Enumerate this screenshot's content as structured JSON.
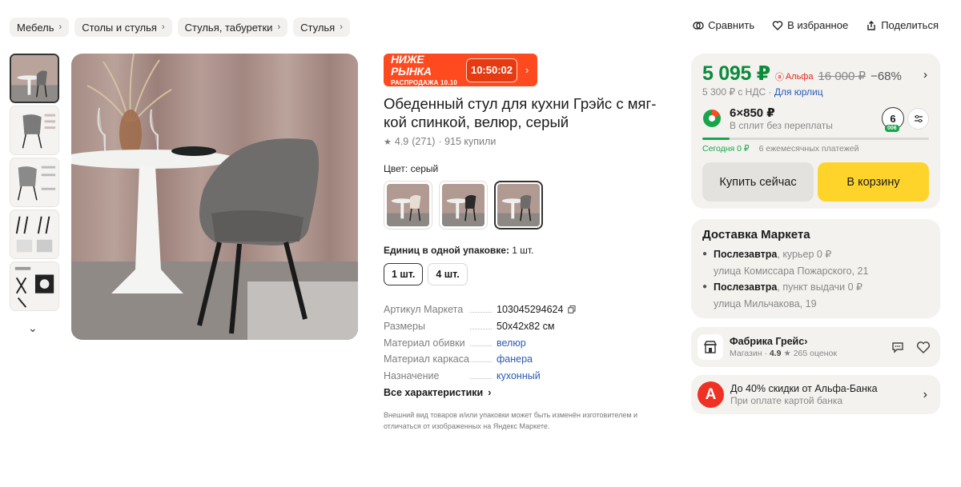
{
  "breadcrumbs": [
    "Мебель",
    "Столы и стулья",
    "Стулья, табуретки",
    "Стулья"
  ],
  "top_actions": {
    "compare": "Сравнить",
    "favorite": "В избранное",
    "share": "Поделиться"
  },
  "promo": {
    "title": "НИЖЕ РЫНКА",
    "subtitle": "РАСПРОДАЖА 10.10",
    "timer": "10:50:02"
  },
  "product": {
    "title": "Обеденный стул для кухни Грэйс с мяг-кой спинкой, велюр, серый",
    "rating": "4.9",
    "reviews": "(271)",
    "bought": "· 915 купили",
    "color_label": "Цвет:",
    "color_value": "серый",
    "pack_label": "Единиц в одной упаковке:",
    "pack_value": "1 шт.",
    "pack_options": [
      "1 шт.",
      "4 шт."
    ],
    "all_specs": "Все характеристики",
    "disclaimer": "Внешний вид товаров и/или упаковки может быть изменён изготовителем и отличаться от изображенных на Яндекс Маркете."
  },
  "specs": [
    {
      "key": "Артикул Маркета",
      "value": "103045294624"
    },
    {
      "key": "Размеры",
      "value": "50x42x82 см"
    },
    {
      "key": "Материал обивки",
      "value": "велюр"
    },
    {
      "key": "Материал каркаса",
      "value": "фанера"
    },
    {
      "key": "Назначение",
      "value": "кухонный"
    }
  ],
  "buybox": {
    "price": "5 095 ₽",
    "alfa_label": "Альфа",
    "old_price": "16 000 ₽",
    "discount": "−68%",
    "nds": "5 300 ₽ с НДС ·",
    "legal": "Для юрлиц",
    "split_main": "6×850 ₽",
    "split_sub": "В сплит без переплаты",
    "split_badge": "6",
    "split_badge_sub": "006",
    "today": "Сегодня 0 ₽",
    "monthly": "6 ежемесячных платежей",
    "buy_now": "Купить сейчас",
    "cart": "В корзину",
    "progress_fraction": 0.12
  },
  "delivery": {
    "title": "Доставка Маркета",
    "items": [
      {
        "when": "Послезавтра",
        "how": ", курьер 0 ₽",
        "addr": "улица Комиссара Пожарского, 21"
      },
      {
        "when": "Послезавтра",
        "how": ", пункт выдачи 0 ₽",
        "addr": "улица Мильчакова, 19"
      }
    ]
  },
  "shop": {
    "name": "Фабрика Грейс",
    "type": "Магазин ·",
    "rating": "4.9",
    "reviews": "★ 265 оценок"
  },
  "alfa_promo": {
    "logo": "А",
    "title": "До 40% скидки от Альфа-Банка",
    "sub": "При оплате картой банка"
  },
  "colors": {
    "green": "#0c8a3a",
    "yellow": "#fed42b",
    "promo": "#ff4a1f",
    "link": "#2a5bb5"
  }
}
